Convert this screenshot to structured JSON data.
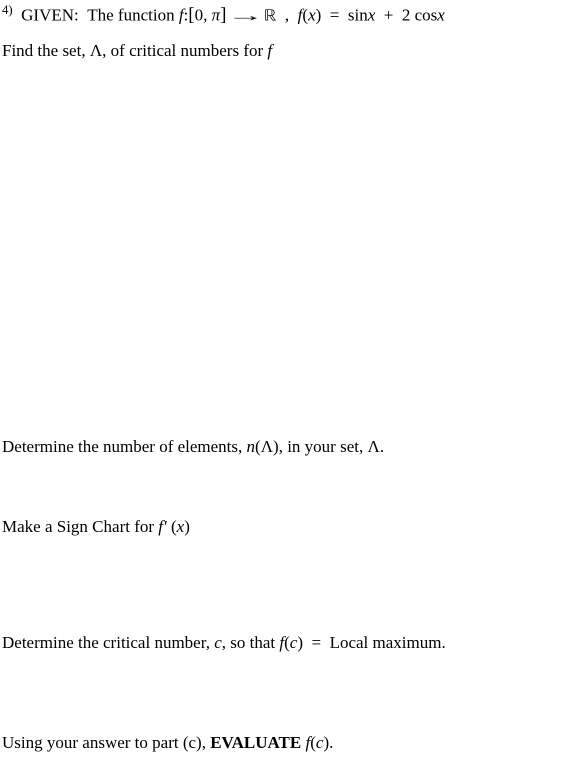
{
  "problem_marker": "4)",
  "given_label": "GIVEN:",
  "given_function_prefix": "The function",
  "given_f_decl_1": "f",
  "given_f_decl_colon": ":",
  "domain_lbracket": "[",
  "domain_a": "0",
  "domain_comma": ",",
  "domain_b": "π",
  "domain_rbracket": "]",
  "arrow_sym": "→",
  "codomain_R": "ℝ",
  "sep_comma": ",",
  "fx_f": "f",
  "fx_paren_open": "(",
  "fx_x": "x",
  "fx_paren_close": ")",
  "eq": "=",
  "rhs_sin": "sin",
  "rhs_x1": "x",
  "rhs_plus": "+",
  "rhs_two": "2",
  "rhs_cos": "cos",
  "rhs_x2": "x",
  "find_prefix": "Find the set,",
  "Lambda1": "Λ",
  "find_mid": ", of critical numbers for",
  "find_f": "f",
  "partn_prefix": "Determine the number of elements,",
  "n_of_lambda_n": "n",
  "n_of_lambda_open": "(",
  "n_of_lambda_L": "Λ",
  "n_of_lambda_close": ")",
  "partn_mid": ", in your set,",
  "Lambda2": "Λ",
  "partn_period": ".",
  "sign_prefix": "Make a Sign Chart for",
  "fprime_f": "f",
  "fprime_prime": "′",
  "fprime_open": "(",
  "fprime_x": "x",
  "fprime_close": ")",
  "localmax_prefix": "Determine the critical number,",
  "localmax_c": "c",
  "localmax_mid": ", so that",
  "fc_f": "f",
  "fc_open": "(",
  "fc_c": "c",
  "fc_close": ")",
  "localmax_eq": "=",
  "localmax_rhs": "Local maximum",
  "localmax_period": ".",
  "eval_prefix1": "Using your answer to part",
  "eval_part_open": "(",
  "eval_part_c": "c",
  "eval_part_close": ")",
  "eval_comma": ",",
  "eval_bold": "EVALUATE",
  "eval_fc_f": "f",
  "eval_fc_open": "(",
  "eval_fc_c": "c",
  "eval_fc_close": ")",
  "eval_period": "."
}
